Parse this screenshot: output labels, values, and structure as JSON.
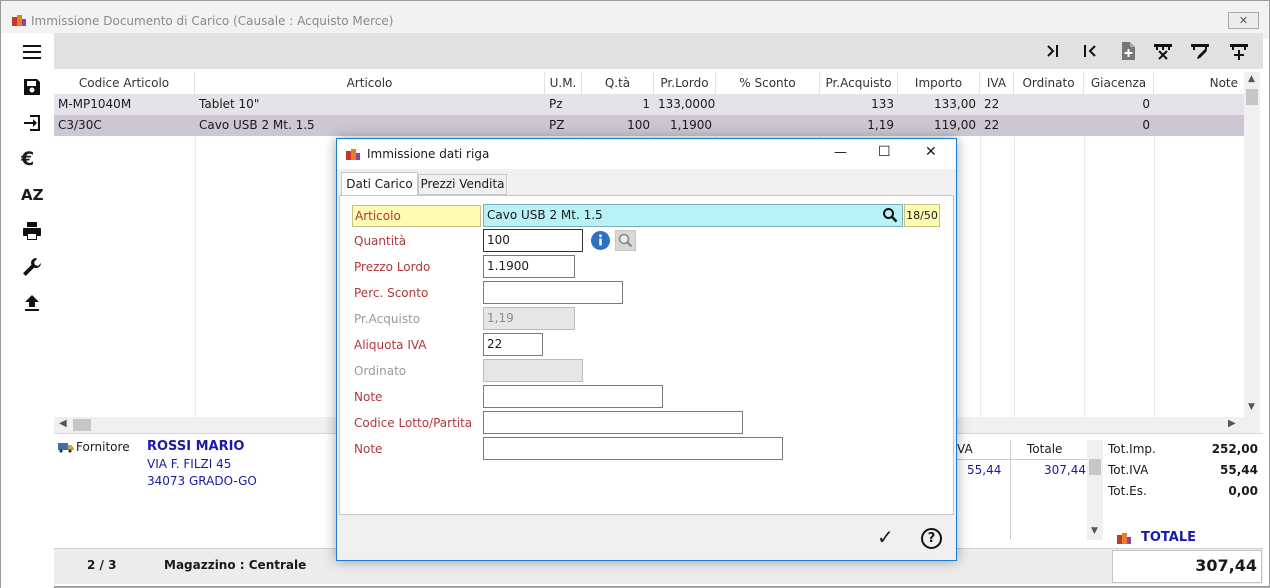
{
  "window": {
    "title": "Immissione Documento di Carico (Causale : Acquisto Merce)",
    "close_label": "✕"
  },
  "sidebar": {
    "euro_symbol": "€",
    "sort_label": "AZ"
  },
  "grid": {
    "headers": [
      "Codice Articolo",
      "Articolo",
      "U.M.",
      "Q.tà",
      "Pr.Lordo",
      "% Sconto",
      "Pr.Acquisto",
      "Importo",
      "IVA",
      "Ordinato",
      "Giacenza",
      "Note"
    ],
    "rows": [
      [
        "M-MP1040M",
        "Tablet 10\"",
        "Pz",
        "1",
        "133,0000",
        "",
        "133",
        "133,00",
        "22",
        "",
        "0",
        ""
      ],
      [
        "C3/30C",
        "Cavo USB 2 Mt. 1.5",
        "PZ",
        "100",
        "1,1900",
        "",
        "1,19",
        "119,00",
        "22",
        "",
        "0",
        ""
      ]
    ]
  },
  "supplier": {
    "label": "Fornitore",
    "name": "ROSSI MARIO",
    "address": "VIA F. FILZI 45",
    "city": "34073 GRADO-GO"
  },
  "vat_table": {
    "col_partial": "VA",
    "col_total": "Totale",
    "rows": [
      {
        "iva": "55,44",
        "totale": "307,44"
      }
    ]
  },
  "totals": {
    "imp_label": "Tot.Imp.",
    "imp_value": "252,00",
    "iva_label": "Tot.IVA",
    "iva_value": "55,44",
    "es_label": "Tot.Es.",
    "es_value": "0,00",
    "grand_label": "TOTALE",
    "grand_value": "307,44"
  },
  "status": {
    "page": "2 / 3",
    "warehouse": "Magazzino : Centrale"
  },
  "dialog": {
    "title": "Immissione dati riga",
    "tabs": [
      "Dati Carico",
      "Prezzi Vendita"
    ],
    "fields": {
      "articolo": {
        "label": "Articolo",
        "value": "Cavo USB 2 Mt. 1.5",
        "counter": "18/50"
      },
      "quantita": {
        "label": "Quantità",
        "value": "100"
      },
      "prezzo_lordo": {
        "label": "Prezzo Lordo",
        "value": "1.1900"
      },
      "perc_sconto": {
        "label": "Perc. Sconto",
        "value": ""
      },
      "pr_acquisto": {
        "label": "Pr.Acquisto",
        "value": "1,19"
      },
      "aliquota_iva": {
        "label": "Aliquota IVA",
        "value": "22"
      },
      "ordinato": {
        "label": "Ordinato",
        "value": ""
      },
      "note": {
        "label": "Note",
        "value": ""
      },
      "codice_lotto": {
        "label": "Codice Lotto/Partita",
        "value": ""
      },
      "note2": {
        "label": "Note",
        "value": ""
      }
    },
    "ok_symbol": "✓",
    "help_symbol": "?",
    "min_symbol": "—",
    "max_symbol": "☐",
    "close_symbol": "✕"
  },
  "colors": {
    "accent": "#1a7fd4",
    "highlight_row": "#e6e2ea",
    "selected_row": "#cdc7d3",
    "label_red": "#b0383a",
    "supplier_blue": "#1a1aa8",
    "counter_bg": "#fffbb0",
    "field_cyan": "#b8f2f6"
  }
}
